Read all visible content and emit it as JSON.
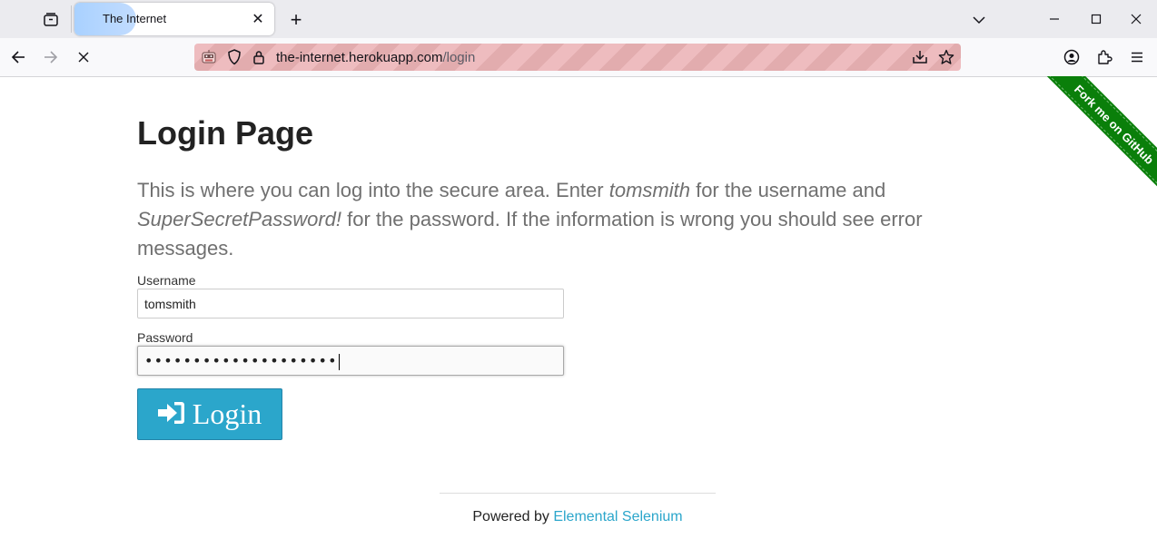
{
  "browser": {
    "tab": {
      "title": "The Internet",
      "close_glyph": "✕"
    },
    "new_tab_glyph": "+",
    "url": {
      "host": "the-internet.herokuapp.com",
      "path": "/login"
    },
    "icons": {
      "tab_overview": "tab-overview-icon",
      "list_all_tabs": "chevron-down-icon",
      "back": "back-arrow-icon",
      "forward": "forward-arrow-icon",
      "stop": "stop-loading-icon",
      "remote_control": "robot-icon",
      "tracking_protection": "shield-icon",
      "site_security": "lock-icon",
      "save_page": "download-icon",
      "bookmark": "star-icon",
      "account": "account-icon",
      "extensions": "puzzle-icon",
      "menu": "hamburger-menu-icon"
    },
    "urlbar_stripe_colors": [
      "#eebcbf",
      "#e2acae"
    ]
  },
  "page": {
    "title": "Login Page",
    "intro": {
      "part1": "This is where you can log into the secure area. Enter ",
      "username_hint": "tomsmith",
      "part2": " for the username and ",
      "password_hint": "SuperSecretPassword!",
      "part3": " for the password. If the information is wrong you should see error messages."
    },
    "form": {
      "username_label": "Username",
      "username_value": "tomsmith",
      "password_label": "Password",
      "password_masked": "••••••••••••••••••••",
      "login_button_label": "Login",
      "login_icon": "sign-in-icon"
    },
    "footer": {
      "prefix": "Powered by ",
      "link_text": "Elemental Selenium"
    },
    "ribbon": {
      "text": "Fork me on GitHub",
      "color": "#0a7f0a"
    },
    "accent_color": "#2ba6cb"
  }
}
